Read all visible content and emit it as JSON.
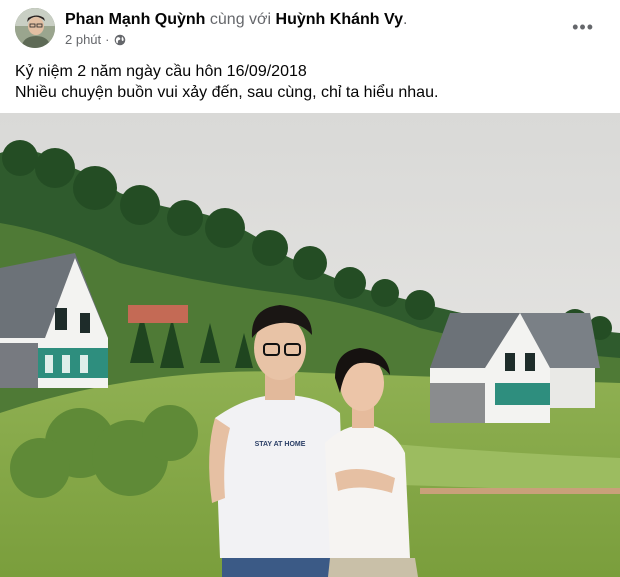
{
  "post": {
    "author": "Phan Mạnh Quỳnh",
    "with_text": "cùng với",
    "tagged": "Huỳnh Khánh Vy",
    "tagged_suffix": ".",
    "time": "2 phút",
    "separator": "·",
    "privacy_icon": "globe-icon",
    "more_icon": "more-options-icon",
    "more_label": "•••",
    "caption_lines": [
      "Kỷ niệm 2 năm ngày cầu hôn 16/09/2018",
      "Nhiều chuyện buồn vui xảy đến, sau cùng, chỉ ta hiểu nhau."
    ],
    "photo": {
      "shirt_text": "STAY AT HOME",
      "colors": {
        "sky": "#e4e4e2",
        "grass": "#86a84a",
        "forest": "#2e5a2c",
        "shirt": "#f2f2f4",
        "pants": "#3b5a86"
      }
    }
  }
}
